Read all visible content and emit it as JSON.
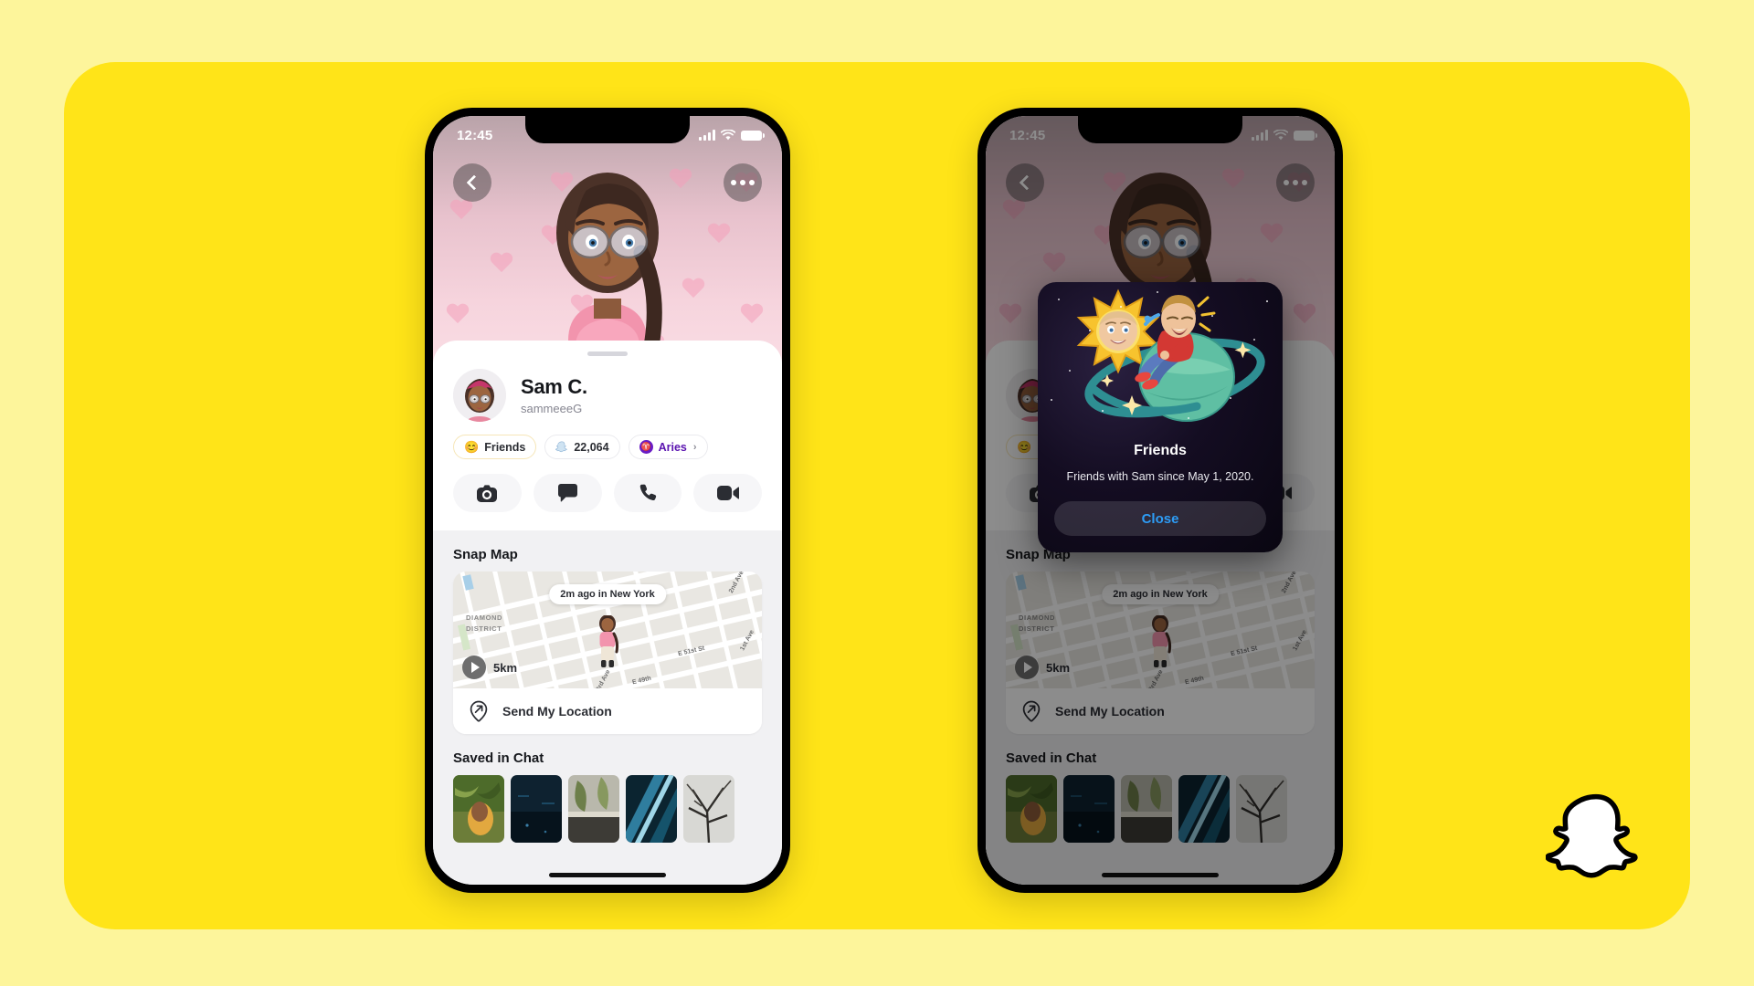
{
  "page": {
    "background_outer": "#FDF59B",
    "panel_color": "#FFE418",
    "brand_logo": "snapchat-ghost-logo"
  },
  "phones": [
    {
      "id": "left",
      "state": "profile",
      "dimmed": false
    },
    {
      "id": "right",
      "state": "profile-with-modal",
      "dimmed": true
    }
  ],
  "status_bar": {
    "time": "12:45",
    "signal_icon": "cellular-signal-icon",
    "wifi_icon": "wifi-icon",
    "battery_icon": "battery-icon"
  },
  "header": {
    "back_icon": "chevron-left-icon",
    "more_icon": "more-options-icon",
    "background_theme": "pink-hearts-bitmoji"
  },
  "profile": {
    "display_name": "Sam C.",
    "username": "sammeeeG",
    "avatar": "bitmoji-avatar",
    "badges": [
      {
        "key": "friendship",
        "emoji": "😊",
        "label": "Friends",
        "icon": "smile-emoji-icon"
      },
      {
        "key": "snapscore",
        "label": "22,064",
        "icon": "snapchat-ghost-icon"
      },
      {
        "key": "zodiac",
        "label": "Aries",
        "glyph": "♈",
        "icon": "zodiac-icon",
        "chevron": "›",
        "color": "#6A1CC4"
      }
    ],
    "actions": [
      {
        "key": "camera",
        "icon": "camera-icon"
      },
      {
        "key": "chat",
        "icon": "chat-bubble-icon"
      },
      {
        "key": "call",
        "icon": "phone-icon"
      },
      {
        "key": "video",
        "icon": "video-camera-icon"
      }
    ]
  },
  "snap_map": {
    "title": "Snap Map",
    "status_pill": "2m ago in New York",
    "district_label": "DIAMOND\nDISTRICT",
    "district_line1": "DIAMOND",
    "district_line2": "DISTRICT",
    "streets": [
      "2nd Ave",
      "1st Ave",
      "E 51st St",
      "E 49th",
      "3rd Ave"
    ],
    "distance": "5km",
    "play_icon": "play-icon",
    "send_location": {
      "label": "Send My Location",
      "icon": "location-arrow-icon"
    }
  },
  "saved_in_chat": {
    "title": "Saved in Chat",
    "thumbnails": [
      {
        "key": "thumb-1",
        "desc": "person-in-yellow-jacket-foliage"
      },
      {
        "key": "thumb-2",
        "desc": "dark-blue-night-scene"
      },
      {
        "key": "thumb-3",
        "desc": "plants-on-balcony"
      },
      {
        "key": "thumb-4",
        "desc": "blue-metallic-abstract"
      },
      {
        "key": "thumb-5",
        "desc": "bare-tree-branches"
      }
    ]
  },
  "modal": {
    "title": "Friends",
    "subtitle": "Friends with Sam since May 1, 2020.",
    "close_label": "Close",
    "close_color": "#2D9CF5",
    "artwork": "bitmoji-sun-and-planet-space-scene"
  }
}
